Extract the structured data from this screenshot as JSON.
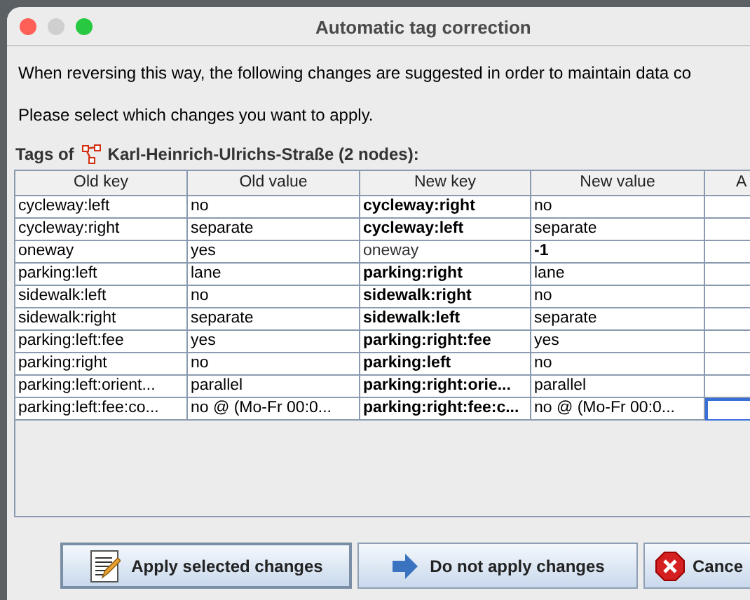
{
  "window": {
    "title": "Automatic tag correction"
  },
  "message": "When reversing this way, the following changes are suggested in order to maintain data co",
  "prompt": "Please select which changes you want to apply.",
  "tags_label": {
    "prefix": "Tags of",
    "name": "Karl-Heinrich-Ulrichs-Straße (2 nodes):"
  },
  "table": {
    "columns": [
      "Old key",
      "Old value",
      "New key",
      "New value",
      "A"
    ],
    "rows": [
      {
        "old_key": "cycleway:left",
        "old_value": "no",
        "new_key": "cycleway:right",
        "key_changed": true,
        "new_value": "no",
        "value_changed": false,
        "focused": false
      },
      {
        "old_key": "cycleway:right",
        "old_value": "separate",
        "new_key": "cycleway:left",
        "key_changed": true,
        "new_value": "separate",
        "value_changed": false,
        "focused": false
      },
      {
        "old_key": "oneway",
        "old_value": "yes",
        "new_key": "oneway",
        "key_changed": false,
        "new_value": "-1",
        "value_changed": true,
        "focused": false
      },
      {
        "old_key": "parking:left",
        "old_value": "lane",
        "new_key": "parking:right",
        "key_changed": true,
        "new_value": "lane",
        "value_changed": false,
        "focused": false
      },
      {
        "old_key": "sidewalk:left",
        "old_value": "no",
        "new_key": "sidewalk:right",
        "key_changed": true,
        "new_value": "no",
        "value_changed": false,
        "focused": false
      },
      {
        "old_key": "sidewalk:right",
        "old_value": "separate",
        "new_key": "sidewalk:left",
        "key_changed": true,
        "new_value": "separate",
        "value_changed": false,
        "focused": false
      },
      {
        "old_key": "parking:left:fee",
        "old_value": "yes",
        "new_key": "parking:right:fee",
        "key_changed": true,
        "new_value": "yes",
        "value_changed": false,
        "focused": false
      },
      {
        "old_key": "parking:right",
        "old_value": "no",
        "new_key": "parking:left",
        "key_changed": true,
        "new_value": "no",
        "value_changed": false,
        "focused": false
      },
      {
        "old_key": "parking:left:orient...",
        "old_value": "parallel",
        "new_key": "parking:right:orie...",
        "key_changed": true,
        "new_value": "parallel",
        "value_changed": false,
        "focused": false
      },
      {
        "old_key": "parking:left:fee:co...",
        "old_value": "no @ (Mo-Fr 00:0...",
        "new_key": "parking:right:fee:c...",
        "key_changed": true,
        "new_value": "no @ (Mo-Fr 00:0...",
        "value_changed": false,
        "focused": true
      }
    ]
  },
  "buttons": [
    {
      "label": "Apply selected changes",
      "kind": "apply"
    },
    {
      "label": "Do not apply changes",
      "kind": "skip"
    },
    {
      "label": "Cance",
      "kind": "cancel"
    }
  ]
}
